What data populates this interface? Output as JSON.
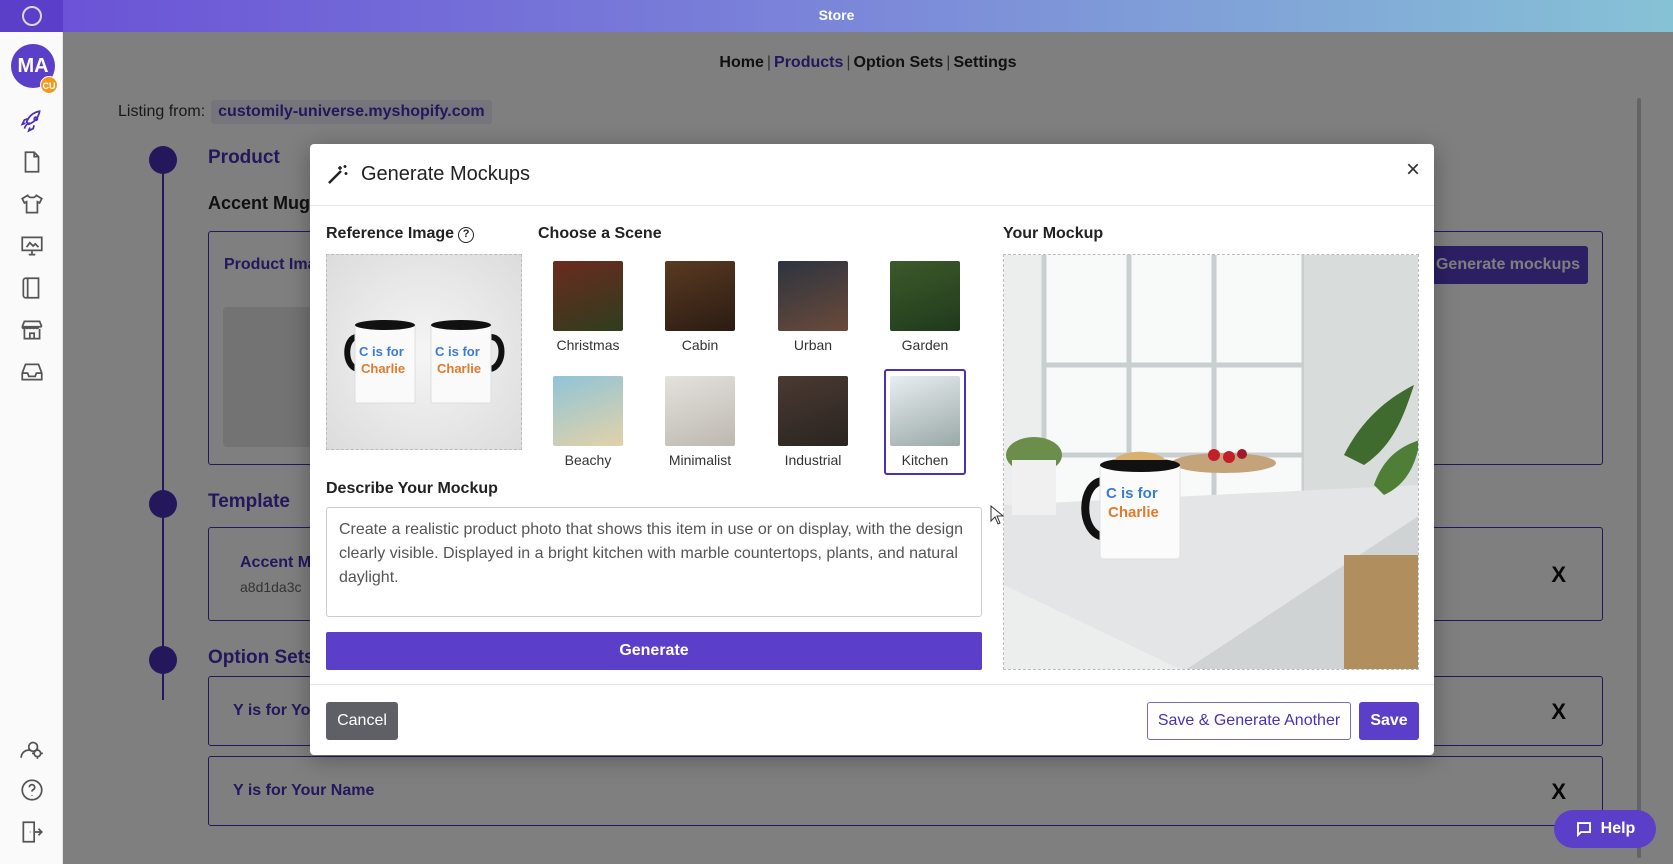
{
  "app": {
    "title": "Store"
  },
  "nav": {
    "items": [
      "Home",
      "Products",
      "Option Sets",
      "Settings"
    ],
    "active": "Products"
  },
  "user": {
    "initials": "MA",
    "badge": "CU"
  },
  "listing": {
    "label": "Listing from:",
    "store": "customily-universe.myshopify.com"
  },
  "background": {
    "product_title": "Product",
    "product_name": "Accent Mug",
    "product_images_label": "Product Ima",
    "generate_mockups_label": "Generate mockups",
    "template_title": "Template",
    "template_name": "Accent M",
    "template_hash": "a8d1da3c",
    "option_sets_title": "Option Sets",
    "option_set_1": "Y is for Yo",
    "option_set_2": "Y is for Your Name",
    "remove_label": "X"
  },
  "modal": {
    "title": "Generate Mockups",
    "close_label": "×",
    "reference_label": "Reference Image",
    "help_glyph": "?",
    "scene_label": "Choose a Scene",
    "mockup_label": "Your Mockup",
    "scenes": [
      {
        "name": "Christmas",
        "colors": [
          "#6b2a1f",
          "#2f3d1e"
        ]
      },
      {
        "name": "Cabin",
        "colors": [
          "#5a3a22",
          "#2b1b12"
        ]
      },
      {
        "name": "Urban",
        "colors": [
          "#2d3440",
          "#6a4a3a"
        ]
      },
      {
        "name": "Garden",
        "colors": [
          "#3c5a2a",
          "#1f3a1c"
        ]
      },
      {
        "name": "Beachy",
        "colors": [
          "#8fc4d8",
          "#e3d2a8"
        ]
      },
      {
        "name": "Minimalist",
        "colors": [
          "#e4e2de",
          "#bdb8b0"
        ]
      },
      {
        "name": "Industrial",
        "colors": [
          "#4a3a32",
          "#2a2420"
        ]
      },
      {
        "name": "Kitchen",
        "colors": [
          "#e8eef0",
          "#9aa8a8"
        ]
      }
    ],
    "selected_scene": "Kitchen",
    "describe_label": "Describe Your Mockup",
    "description": "Create a realistic product photo that shows this item in use or on display, with the design clearly visible. Displayed in a bright kitchen with marble countertops, plants, and natural daylight.",
    "generate_label": "Generate",
    "cancel_label": "Cancel",
    "save_another_label": "Save & Generate Another",
    "save_label": "Save",
    "mug_text_line1": "C is for",
    "mug_text_line2": "Charlie"
  },
  "help": {
    "label": "Help"
  },
  "colors": {
    "brand": "#5b3fc8",
    "accent": "#4b2fb8",
    "badge": "#f29a1f"
  }
}
